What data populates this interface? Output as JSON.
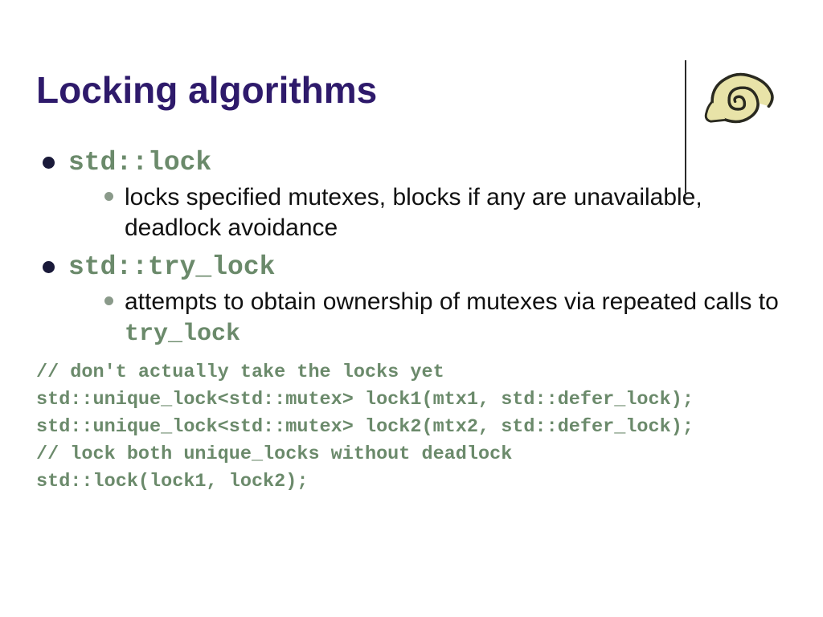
{
  "title": "Locking algorithms",
  "bullets": [
    {
      "label": "std::lock",
      "sub": {
        "text_before": "locks specified mutexes, blocks if any are unavailable, deadlock avoidance",
        "code_inline": "",
        "text_after": ""
      }
    },
    {
      "label": "std::try_lock",
      "sub": {
        "text_before": "attempts to obtain ownership of mutexes via repeated calls to ",
        "code_inline": "try_lock",
        "text_after": ""
      }
    }
  ],
  "code_lines": [
    "// don't actually take the locks yet",
    "std::unique_lock<std::mutex> lock1(mtx1, std::defer_lock);",
    "std::unique_lock<std::mutex> lock2(mtx2, std::defer_lock);",
    "// lock both unique_locks without deadlock",
    "std::lock(lock1, lock2);"
  ]
}
